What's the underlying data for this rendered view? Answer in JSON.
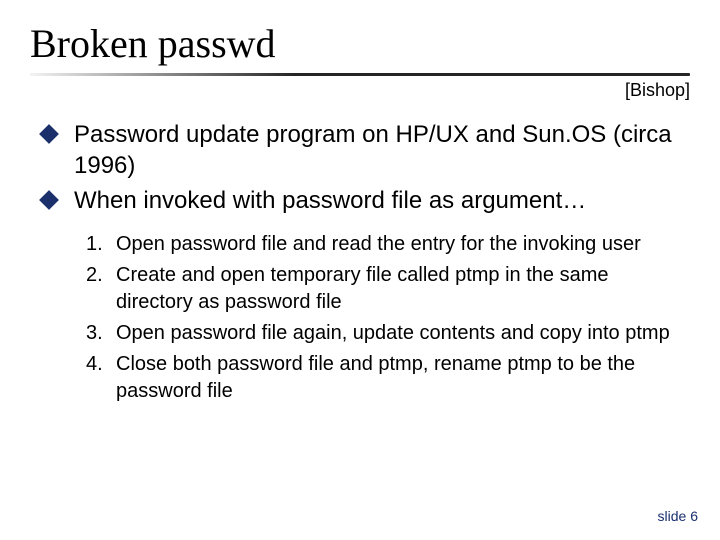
{
  "title": "Broken passwd",
  "attribution": "[Bishop]",
  "bullets": [
    "Password update program on HP/UX and Sun.OS (circa 1996)",
    "When invoked with password file as argument…"
  ],
  "steps": [
    "Open password file and read the entry for the invoking user",
    "Create and open temporary file called ptmp in the same directory as password file",
    "Open password file again, update contents and copy into ptmp",
    "Close both password file and ptmp, rename ptmp to be the password file"
  ],
  "footer": "slide 6"
}
